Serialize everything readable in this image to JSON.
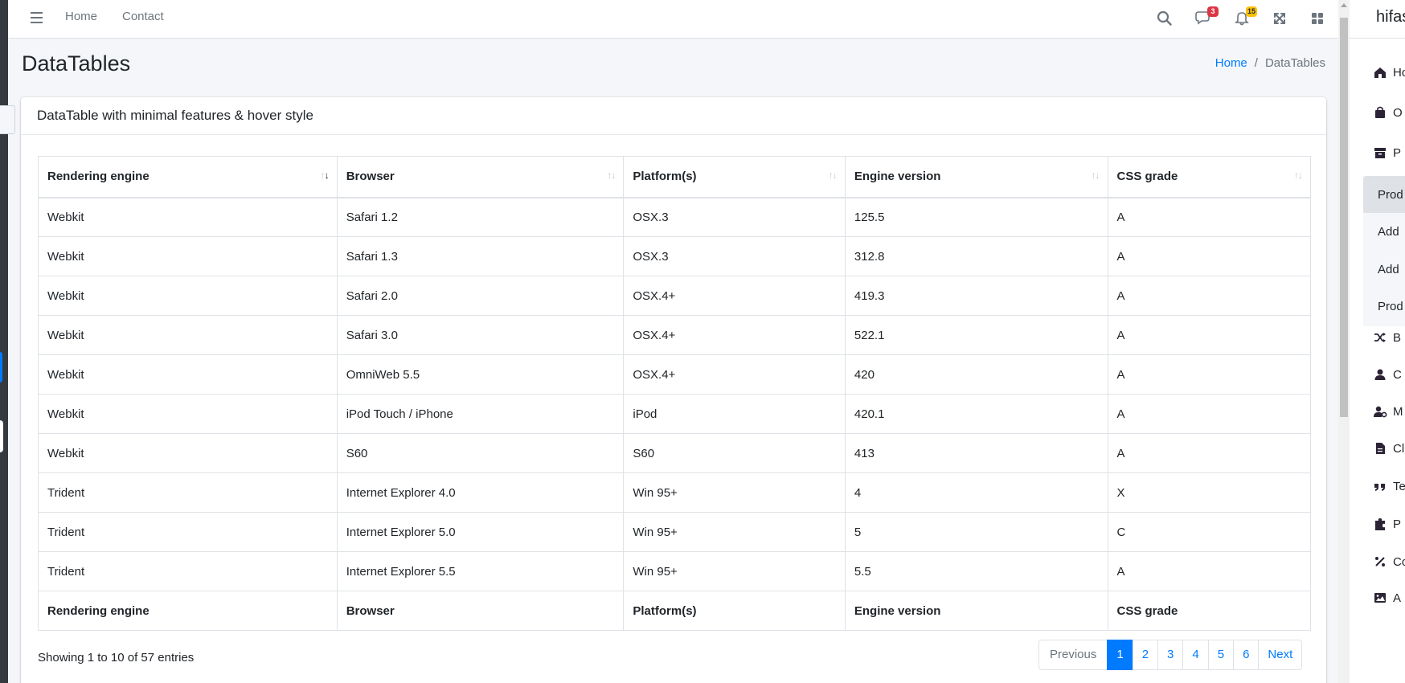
{
  "navbar": {
    "links": [
      "Home",
      "Contact"
    ],
    "messages_badge": "3",
    "notifications_badge": "15"
  },
  "page": {
    "title": "DataTables",
    "breadcrumb": [
      "Home",
      "DataTables"
    ]
  },
  "card": {
    "title": "DataTable with minimal features & hover style"
  },
  "table": {
    "columns": [
      "Rendering engine",
      "Browser",
      "Platform(s)",
      "Engine version",
      "CSS grade"
    ],
    "rows": [
      [
        "Webkit",
        "Safari 1.2",
        "OSX.3",
        "125.5",
        "A"
      ],
      [
        "Webkit",
        "Safari 1.3",
        "OSX.3",
        "312.8",
        "A"
      ],
      [
        "Webkit",
        "Safari 2.0",
        "OSX.4+",
        "419.3",
        "A"
      ],
      [
        "Webkit",
        "Safari 3.0",
        "OSX.4+",
        "522.1",
        "A"
      ],
      [
        "Webkit",
        "OmniWeb 5.5",
        "OSX.4+",
        "420",
        "A"
      ],
      [
        "Webkit",
        "iPod Touch / iPhone",
        "iPod",
        "420.1",
        "A"
      ],
      [
        "Webkit",
        "S60",
        "S60",
        "413",
        "A"
      ],
      [
        "Trident",
        "Internet Explorer 4.0",
        "Win 95+",
        "4",
        "X"
      ],
      [
        "Trident",
        "Internet Explorer 5.0",
        "Win 95+",
        "5",
        "C"
      ],
      [
        "Trident",
        "Internet Explorer 5.5",
        "Win 95+",
        "5.5",
        "A"
      ]
    ],
    "info": "Showing 1 to 10 of 57 entries",
    "pagination": {
      "previous": "Previous",
      "pages": [
        "1",
        "2",
        "3",
        "4",
        "5",
        "6"
      ],
      "active_page": "1",
      "next": "Next"
    }
  },
  "right_sidebar": {
    "brand": "hifas",
    "items": [
      {
        "icon": "home-icon",
        "label": "Ho"
      },
      {
        "icon": "shopping-bag-icon",
        "label": "O"
      },
      {
        "icon": "archive-icon",
        "label": "P"
      },
      {
        "icon": "shuffle-icon",
        "label": "B"
      },
      {
        "icon": "user-icon",
        "label": "C"
      },
      {
        "icon": "user-gear-icon",
        "label": "M"
      },
      {
        "icon": "file-icon",
        "label": "Cl"
      },
      {
        "icon": "quote-icon",
        "label": "Te"
      },
      {
        "icon": "puzzle-icon",
        "label": "P"
      },
      {
        "icon": "percent-icon",
        "label": "Co"
      },
      {
        "icon": "image-icon",
        "label": "A"
      }
    ],
    "submenu": [
      "Prod",
      "Add",
      "Add",
      "Prod"
    ]
  },
  "colors": {
    "accent": "#007bff",
    "sidebar_dark": "#343a40",
    "badge_red": "#dc3545",
    "badge_yellow": "#ffc107"
  }
}
